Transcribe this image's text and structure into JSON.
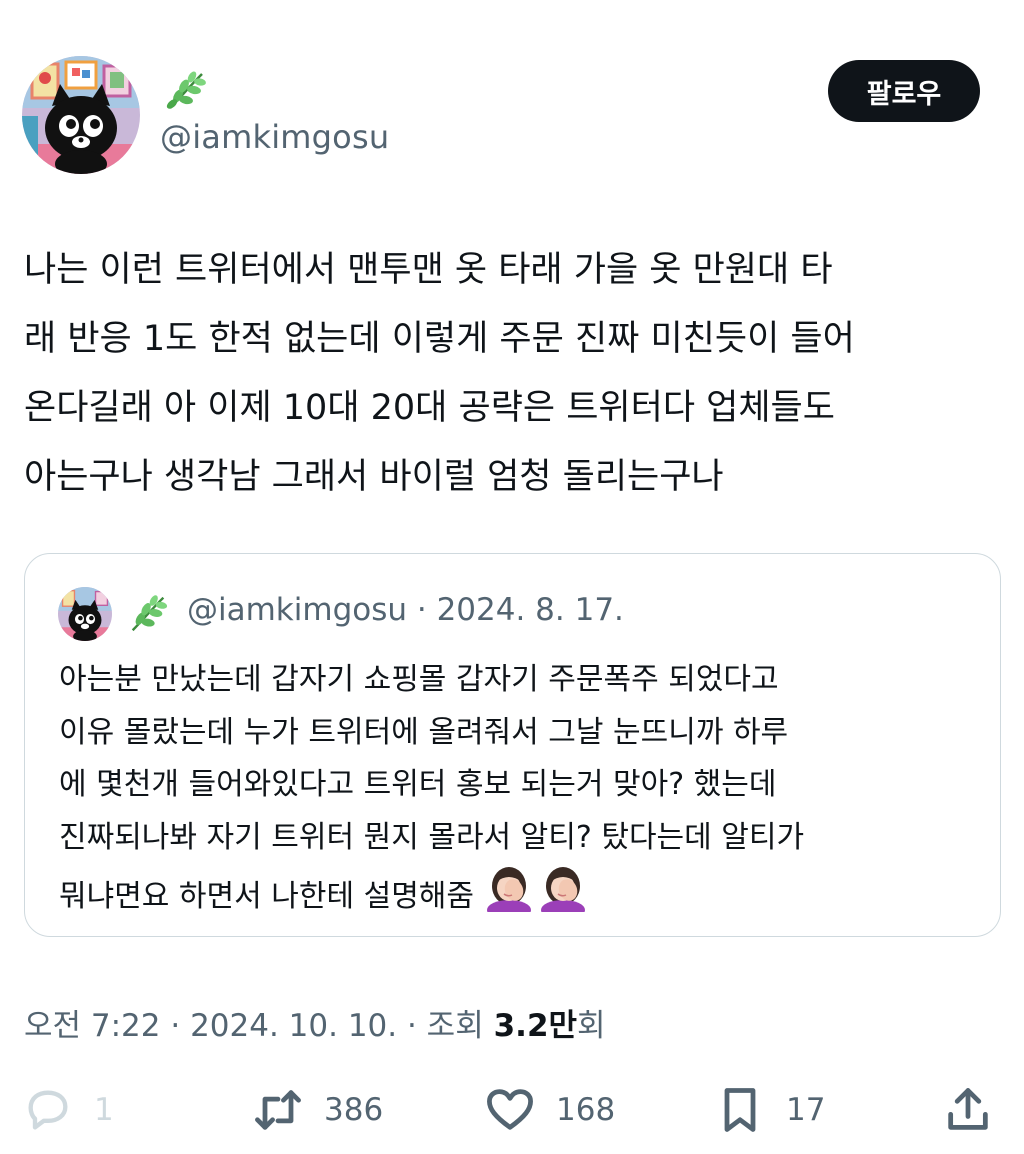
{
  "author": {
    "name_emoji": "herb-emoji",
    "handle": "@iamkimgosu"
  },
  "follow_label": "팔로우",
  "tweet_text": "나는 이런 트위터에서 맨투맨 옷 타래 가을 옷 만원대 타\n래 반응 1도 한적 없는데 이렇게 주문 진짜 미친듯이 들어\n온다길래 아 이제 10대 20대 공략은 트위터다 업체들도\n아는구나 생각남 그래서 바이럴 엄청 돌리는구나",
  "quoted": {
    "handle": "@iamkimgosu",
    "separator": " · ",
    "date": "2024. 8. 17.",
    "text": "아는분 만났는데 갑자기 쇼핑몰 갑자기 주문폭주 되었다고\n이유 몰랐는데 누가 트위터에 올려줘서 그날 눈뜨니까 하루\n에 몇천개 들어와있다고 트위터 홍보 되는거 맞아? 했는데\n진짜되나봐 자기 트위터 뭔지 몰라서 알티? 탔다는데 알티가\n뭐냐면요 하면서 나한테 설명해줌",
    "trailing_emoji": [
      "woman-facepalming-emoji",
      "woman-facepalming-emoji"
    ]
  },
  "timestamp": {
    "text": "오전 7:22 · 2024. 10. 10. · 조회 ",
    "views_value": "3.2만",
    "views_suffix": "회"
  },
  "actions": {
    "reply_count": "1",
    "retweet_count": "386",
    "like_count": "168",
    "bookmark_count": "17"
  },
  "colors": {
    "text_primary": "#0f1419",
    "text_secondary": "#536471",
    "border": "#cfd9de",
    "button_bg": "#0f1419"
  }
}
